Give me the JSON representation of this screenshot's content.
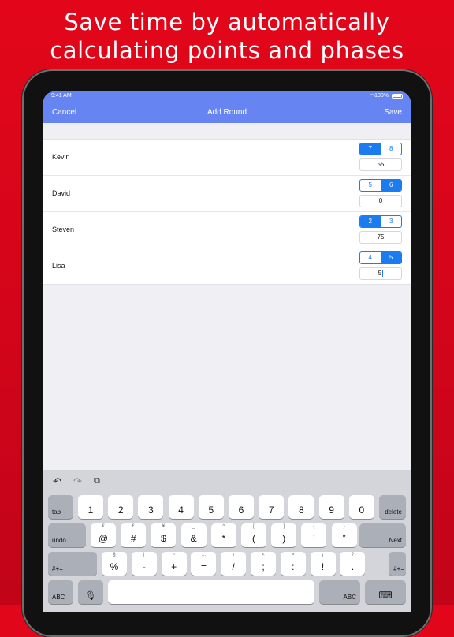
{
  "headline": [
    "Save time by automatically",
    "calculating points and phases"
  ],
  "status": {
    "time": "9:41 AM",
    "battery": "100%"
  },
  "nav": {
    "cancel": "Cancel",
    "title": "Add Round",
    "save": "Save"
  },
  "players": [
    {
      "name": "Kevin",
      "phase_options": [
        "7",
        "8"
      ],
      "selected": 0,
      "points": "55"
    },
    {
      "name": "David",
      "phase_options": [
        "5",
        "6"
      ],
      "selected": 1,
      "points": "0"
    },
    {
      "name": "Steven",
      "phase_options": [
        "2",
        "3"
      ],
      "selected": 0,
      "points": "75"
    },
    {
      "name": "Lisa",
      "phase_options": [
        "4",
        "5"
      ],
      "selected": 1,
      "points": "5"
    }
  ],
  "keyboard": {
    "tools": {
      "undo": "undo-icon",
      "redo": "redo-icon",
      "paste": "paste-icon"
    },
    "row1": {
      "left": "tab",
      "keys": [
        {
          "m": "1",
          "s": ""
        },
        {
          "m": "2",
          "s": ""
        },
        {
          "m": "3",
          "s": ""
        },
        {
          "m": "4",
          "s": ""
        },
        {
          "m": "5",
          "s": ""
        },
        {
          "m": "6",
          "s": ""
        },
        {
          "m": "7",
          "s": ""
        },
        {
          "m": "8",
          "s": ""
        },
        {
          "m": "9",
          "s": ""
        },
        {
          "m": "0",
          "s": ""
        }
      ],
      "right": "delete"
    },
    "row2": {
      "left": "undo",
      "keys": [
        {
          "m": "@",
          "s": "€"
        },
        {
          "m": "#",
          "s": "£"
        },
        {
          "m": "$",
          "s": "¥"
        },
        {
          "m": "&",
          "s": "_"
        },
        {
          "m": "*",
          "s": "^"
        },
        {
          "m": "(",
          "s": "["
        },
        {
          "m": ")",
          "s": "]"
        },
        {
          "m": "’",
          "s": "{"
        },
        {
          "m": "”",
          "s": "}"
        }
      ],
      "right": "Next"
    },
    "row3": {
      "left": "#+=",
      "keys": [
        {
          "m": "%",
          "s": "§"
        },
        {
          "m": "-",
          "s": "|"
        },
        {
          "m": "+",
          "s": "~"
        },
        {
          "m": "=",
          "s": "…"
        },
        {
          "m": "/",
          "s": "\\"
        },
        {
          "m": ";",
          "s": "<"
        },
        {
          "m": ":",
          "s": ">"
        },
        {
          "m": "!",
          "s": "¡"
        },
        {
          "m": ".",
          "s": "?"
        }
      ],
      "right": "#+="
    },
    "row4": {
      "left": "ABC",
      "right": "ABC"
    }
  }
}
